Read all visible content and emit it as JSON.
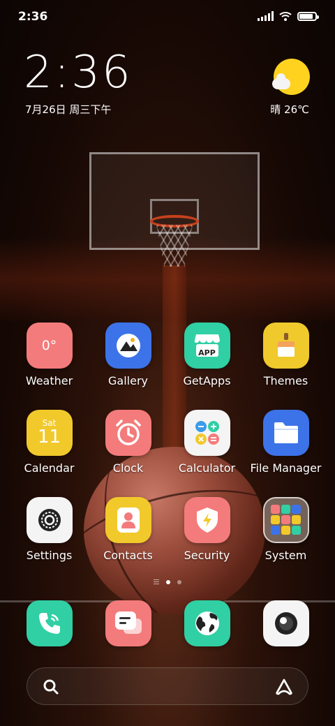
{
  "status_bar": {
    "time": "2:36",
    "battery_level": 0.95
  },
  "clock_widget": {
    "time": "2:36",
    "date": "7月26日 周三下午"
  },
  "weather_widget": {
    "text": "晴 26℃",
    "icon": "sunny-partly-cloudy-icon"
  },
  "apps": [
    {
      "label": "Weather",
      "icon": "weather-icon",
      "color": "#f47b7b",
      "icon_text": "0°"
    },
    {
      "label": "Gallery",
      "icon": "gallery-icon",
      "color": "#3d73e8"
    },
    {
      "label": "GetApps",
      "icon": "getapps-icon",
      "color": "#30cfa4",
      "icon_text": "APP"
    },
    {
      "label": "Themes",
      "icon": "themes-icon",
      "color": "#f0c92c"
    },
    {
      "label": "Calendar",
      "icon": "calendar-icon",
      "color": "#f2c92b",
      "icon_day": "Sat",
      "icon_date": "11"
    },
    {
      "label": "Clock",
      "icon": "clock-icon",
      "color": "#f47b7b"
    },
    {
      "label": "Calculator",
      "icon": "calculator-icon",
      "color": "#f4f4f4"
    },
    {
      "label": "File Manager",
      "icon": "file-manager-icon",
      "color": "#3d73e8"
    },
    {
      "label": "Settings",
      "icon": "settings-icon",
      "color": "#f4f4f4"
    },
    {
      "label": "Contacts",
      "icon": "contacts-icon",
      "color": "#f2c92b"
    },
    {
      "label": "Security",
      "icon": "security-icon",
      "color": "#f47b7b"
    },
    {
      "label": "System",
      "icon": "system-folder-icon",
      "color": "#d9c9b8"
    }
  ],
  "page_indicator": {
    "pages": 2,
    "active": 0
  },
  "dock": [
    {
      "icon": "phone-icon",
      "color": "#30cfa4"
    },
    {
      "icon": "messages-icon",
      "color": "#f47b7b"
    },
    {
      "icon": "browser-icon",
      "color": "#30cfa4"
    },
    {
      "icon": "camera-icon",
      "color": "#f4f4f4"
    }
  ],
  "search": {
    "icon": "search-icon",
    "assistant_icon": "assistant-icon"
  }
}
